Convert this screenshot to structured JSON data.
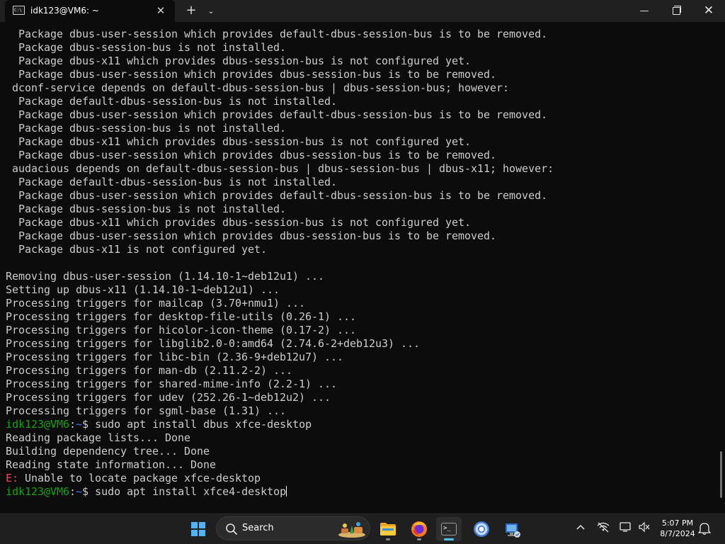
{
  "window": {
    "tab_title": "idk123@VM6: ~",
    "tab_icon_text": "C:\\",
    "tab_close": "✕",
    "new_tab": "+",
    "tab_dropdown": "⌄",
    "minimize": "—",
    "close": "✕"
  },
  "terminal": {
    "lines": [
      {
        "text": "  Package dbus-user-session which provides default-dbus-session-bus is to be removed."
      },
      {
        "text": "  Package dbus-session-bus is not installed."
      },
      {
        "text": "  Package dbus-x11 which provides dbus-session-bus is not configured yet."
      },
      {
        "text": "  Package dbus-user-session which provides dbus-session-bus is to be removed."
      },
      {
        "text": " dconf-service depends on default-dbus-session-bus | dbus-session-bus; however:"
      },
      {
        "text": "  Package default-dbus-session-bus is not installed."
      },
      {
        "text": "  Package dbus-user-session which provides default-dbus-session-bus is to be removed."
      },
      {
        "text": "  Package dbus-session-bus is not installed."
      },
      {
        "text": "  Package dbus-x11 which provides dbus-session-bus is not configured yet."
      },
      {
        "text": "  Package dbus-user-session which provides dbus-session-bus is to be removed."
      },
      {
        "text": " audacious depends on default-dbus-session-bus | dbus-session-bus | dbus-x11; however:"
      },
      {
        "text": "  Package default-dbus-session-bus is not installed."
      },
      {
        "text": "  Package dbus-user-session which provides default-dbus-session-bus is to be removed."
      },
      {
        "text": "  Package dbus-session-bus is not installed."
      },
      {
        "text": "  Package dbus-x11 which provides dbus-session-bus is not configured yet."
      },
      {
        "text": "  Package dbus-user-session which provides dbus-session-bus is to be removed."
      },
      {
        "text": "  Package dbus-x11 is not configured yet."
      },
      {
        "text": ""
      },
      {
        "text": "Removing dbus-user-session (1.14.10-1~deb12u1) ..."
      },
      {
        "text": "Setting up dbus-x11 (1.14.10-1~deb12u1) ..."
      },
      {
        "text": "Processing triggers for mailcap (3.70+nmu1) ..."
      },
      {
        "text": "Processing triggers for desktop-file-utils (0.26-1) ..."
      },
      {
        "text": "Processing triggers for hicolor-icon-theme (0.17-2) ..."
      },
      {
        "text": "Processing triggers for libglib2.0-0:amd64 (2.74.6-2+deb12u3) ..."
      },
      {
        "text": "Processing triggers for libc-bin (2.36-9+deb12u7) ..."
      },
      {
        "text": "Processing triggers for man-db (2.11.2-2) ..."
      },
      {
        "text": "Processing triggers for shared-mime-info (2.2-1) ..."
      },
      {
        "text": "Processing triggers for udev (252.26-1~deb12u2) ..."
      },
      {
        "text": "Processing triggers for sgml-base (1.31) ..."
      },
      {
        "user": "idk123@VM6",
        "path": "~",
        "symbol": "$",
        "text": " sudo apt install dbus xfce-desktop"
      },
      {
        "text": "Reading package lists... Done"
      },
      {
        "text": "Building dependency tree... Done"
      },
      {
        "text": "Reading state information... Done"
      },
      {
        "err": "E:",
        "text": " Unable to locate package xfce-desktop"
      },
      {
        "user": "idk123@VM6",
        "path": "~",
        "symbol": "$",
        "text": " sudo apt install xfce4-desktop",
        "cursor": true
      }
    ]
  },
  "taskbar": {
    "search_label": "Search",
    "clock_time": "5:07 PM",
    "clock_date": "8/7/2024",
    "tray_chevron": "^"
  },
  "colors": {
    "background": "#0c0c0c",
    "foreground": "#cccccc",
    "prompt_user": "#13a10e",
    "prompt_path": "#3b78ff",
    "error": "#e74856",
    "taskbar": "#1f1f1f"
  }
}
